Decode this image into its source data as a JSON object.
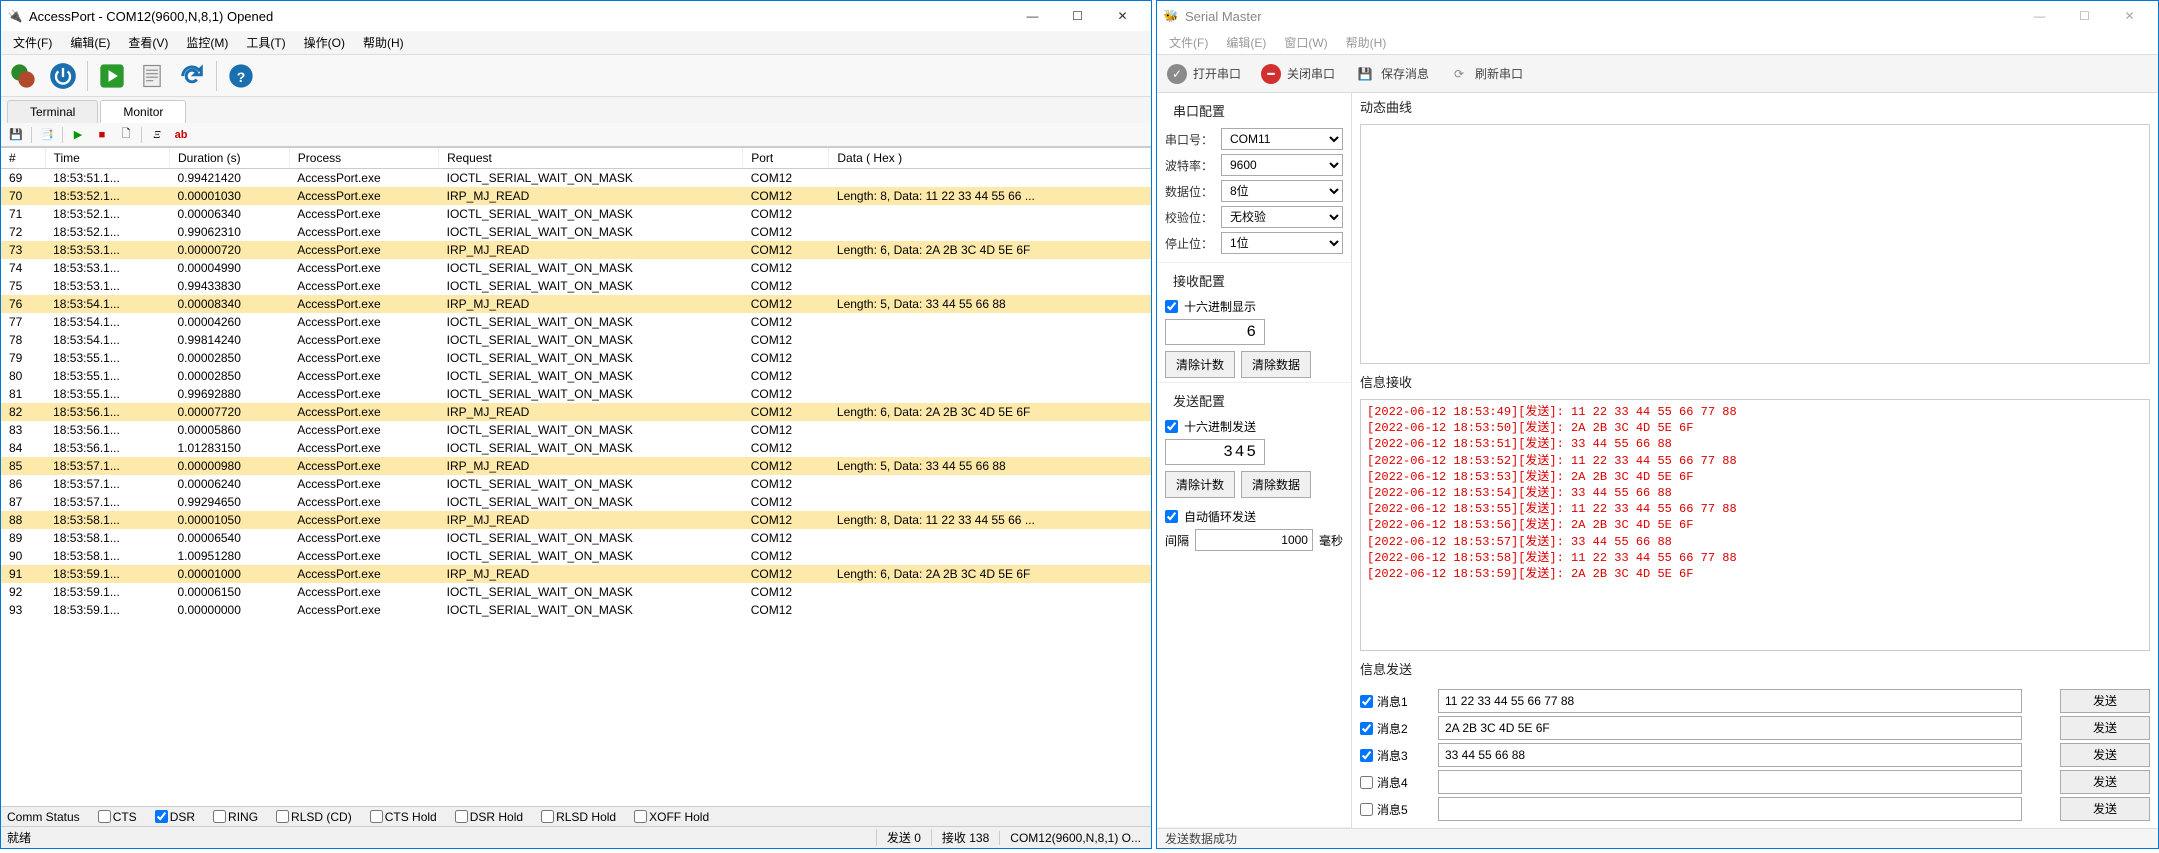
{
  "left": {
    "title": "AccessPort - COM12(9600,N,8,1) Opened",
    "menu": [
      "文件(F)",
      "编辑(E)",
      "查看(V)",
      "监控(M)",
      "工具(T)",
      "操作(O)",
      "帮助(H)"
    ],
    "tabs": {
      "terminal": "Terminal",
      "monitor": "Monitor"
    },
    "columns": [
      "#",
      "Time",
      "Duration (s)",
      "Process",
      "Request",
      "Port",
      "Data ( Hex )"
    ],
    "rows": [
      {
        "n": "69",
        "t": "18:53:51.1...",
        "d": "0.99421420",
        "p": "AccessPort.exe",
        "r": "IOCTL_SERIAL_WAIT_ON_MASK",
        "port": "COM12",
        "data": "",
        "hl": false
      },
      {
        "n": "70",
        "t": "18:53:52.1...",
        "d": "0.00001030",
        "p": "AccessPort.exe",
        "r": "IRP_MJ_READ",
        "port": "COM12",
        "data": "Length: 8, Data: 11 22 33 44 55 66 ...",
        "hl": true
      },
      {
        "n": "71",
        "t": "18:53:52.1...",
        "d": "0.00006340",
        "p": "AccessPort.exe",
        "r": "IOCTL_SERIAL_WAIT_ON_MASK",
        "port": "COM12",
        "data": "",
        "hl": false
      },
      {
        "n": "72",
        "t": "18:53:52.1...",
        "d": "0.99062310",
        "p": "AccessPort.exe",
        "r": "IOCTL_SERIAL_WAIT_ON_MASK",
        "port": "COM12",
        "data": "",
        "hl": false
      },
      {
        "n": "73",
        "t": "18:53:53.1...",
        "d": "0.00000720",
        "p": "AccessPort.exe",
        "r": "IRP_MJ_READ",
        "port": "COM12",
        "data": "Length: 6, Data: 2A 2B 3C 4D 5E 6F",
        "hl": true
      },
      {
        "n": "74",
        "t": "18:53:53.1...",
        "d": "0.00004990",
        "p": "AccessPort.exe",
        "r": "IOCTL_SERIAL_WAIT_ON_MASK",
        "port": "COM12",
        "data": "",
        "hl": false
      },
      {
        "n": "75",
        "t": "18:53:53.1...",
        "d": "0.99433830",
        "p": "AccessPort.exe",
        "r": "IOCTL_SERIAL_WAIT_ON_MASK",
        "port": "COM12",
        "data": "",
        "hl": false
      },
      {
        "n": "76",
        "t": "18:53:54.1...",
        "d": "0.00008340",
        "p": "AccessPort.exe",
        "r": "IRP_MJ_READ",
        "port": "COM12",
        "data": "Length: 5, Data: 33 44 55 66 88",
        "hl": true
      },
      {
        "n": "77",
        "t": "18:53:54.1...",
        "d": "0.00004260",
        "p": "AccessPort.exe",
        "r": "IOCTL_SERIAL_WAIT_ON_MASK",
        "port": "COM12",
        "data": "",
        "hl": false
      },
      {
        "n": "78",
        "t": "18:53:54.1...",
        "d": "0.99814240",
        "p": "AccessPort.exe",
        "r": "IOCTL_SERIAL_WAIT_ON_MASK",
        "port": "COM12",
        "data": "",
        "hl": false
      },
      {
        "n": "79",
        "t": "18:53:55.1...",
        "d": "0.00002850",
        "p": "AccessPort.exe",
        "r": "IOCTL_SERIAL_WAIT_ON_MASK",
        "port": "COM12",
        "data": "",
        "hl": false
      },
      {
        "n": "80",
        "t": "18:53:55.1...",
        "d": "0.00002850",
        "p": "AccessPort.exe",
        "r": "IOCTL_SERIAL_WAIT_ON_MASK",
        "port": "COM12",
        "data": "",
        "hl": false
      },
      {
        "n": "81",
        "t": "18:53:55.1...",
        "d": "0.99692880",
        "p": "AccessPort.exe",
        "r": "IOCTL_SERIAL_WAIT_ON_MASK",
        "port": "COM12",
        "data": "",
        "hl": false
      },
      {
        "n": "82",
        "t": "18:53:56.1...",
        "d": "0.00007720",
        "p": "AccessPort.exe",
        "r": "IRP_MJ_READ",
        "port": "COM12",
        "data": "Length: 6, Data: 2A 2B 3C 4D 5E 6F",
        "hl": true
      },
      {
        "n": "83",
        "t": "18:53:56.1...",
        "d": "0.00005860",
        "p": "AccessPort.exe",
        "r": "IOCTL_SERIAL_WAIT_ON_MASK",
        "port": "COM12",
        "data": "",
        "hl": false
      },
      {
        "n": "84",
        "t": "18:53:56.1...",
        "d": "1.01283150",
        "p": "AccessPort.exe",
        "r": "IOCTL_SERIAL_WAIT_ON_MASK",
        "port": "COM12",
        "data": "",
        "hl": false
      },
      {
        "n": "85",
        "t": "18:53:57.1...",
        "d": "0.00000980",
        "p": "AccessPort.exe",
        "r": "IRP_MJ_READ",
        "port": "COM12",
        "data": "Length: 5, Data: 33 44 55 66 88",
        "hl": true
      },
      {
        "n": "86",
        "t": "18:53:57.1...",
        "d": "0.00006240",
        "p": "AccessPort.exe",
        "r": "IOCTL_SERIAL_WAIT_ON_MASK",
        "port": "COM12",
        "data": "",
        "hl": false
      },
      {
        "n": "87",
        "t": "18:53:57.1...",
        "d": "0.99294650",
        "p": "AccessPort.exe",
        "r": "IOCTL_SERIAL_WAIT_ON_MASK",
        "port": "COM12",
        "data": "",
        "hl": false
      },
      {
        "n": "88",
        "t": "18:53:58.1...",
        "d": "0.00001050",
        "p": "AccessPort.exe",
        "r": "IRP_MJ_READ",
        "port": "COM12",
        "data": "Length: 8, Data: 11 22 33 44 55 66 ...",
        "hl": true
      },
      {
        "n": "89",
        "t": "18:53:58.1...",
        "d": "0.00006540",
        "p": "AccessPort.exe",
        "r": "IOCTL_SERIAL_WAIT_ON_MASK",
        "port": "COM12",
        "data": "",
        "hl": false
      },
      {
        "n": "90",
        "t": "18:53:58.1...",
        "d": "1.00951280",
        "p": "AccessPort.exe",
        "r": "IOCTL_SERIAL_WAIT_ON_MASK",
        "port": "COM12",
        "data": "",
        "hl": false
      },
      {
        "n": "91",
        "t": "18:53:59.1...",
        "d": "0.00001000",
        "p": "AccessPort.exe",
        "r": "IRP_MJ_READ",
        "port": "COM12",
        "data": "Length: 6, Data: 2A 2B 3C 4D 5E 6F",
        "hl": true
      },
      {
        "n": "92",
        "t": "18:53:59.1...",
        "d": "0.00006150",
        "p": "AccessPort.exe",
        "r": "IOCTL_SERIAL_WAIT_ON_MASK",
        "port": "COM12",
        "data": "",
        "hl": false
      },
      {
        "n": "93",
        "t": "18:53:59.1...",
        "d": "0.00000000",
        "p": "AccessPort.exe",
        "r": "IOCTL_SERIAL_WAIT_ON_MASK",
        "port": "COM12",
        "data": "",
        "hl": false
      }
    ],
    "comm": {
      "label": "Comm Status",
      "cts": "CTS",
      "dsr": "DSR",
      "ring": "RING",
      "rlsd": "RLSD (CD)",
      "ctsh": "CTS Hold",
      "dsrh": "DSR Hold",
      "rlsdh": "RLSD Hold",
      "xoffh": "XOFF Hold"
    },
    "status": {
      "ready": "就绪",
      "tx": "发送 0",
      "rx": "接收 138",
      "port": "COM12(9600,N,8,1) O..."
    }
  },
  "right": {
    "title": "Serial Master",
    "menu": [
      "文件(F)",
      "编辑(E)",
      "窗口(W)",
      "帮助(H)"
    ],
    "tb": {
      "open": "打开串口",
      "close": "关闭串口",
      "save": "保存消息",
      "refresh": "刷新串口"
    },
    "cfg": {
      "title": "串口配置",
      "port_l": "串口号：",
      "port_v": "COM11",
      "baud_l": "波特率：",
      "baud_v": "9600",
      "bits_l": "数据位：",
      "bits_v": "8位",
      "par_l": "校验位：",
      "par_v": "无校验",
      "stop_l": "停止位：",
      "stop_v": "1位"
    },
    "rxcfg": {
      "title": "接收配置",
      "hex": "十六进制显示",
      "count": "6",
      "clrc": "清除计数",
      "clrd": "清除数据"
    },
    "txcfg": {
      "title": "发送配置",
      "hex": "十六进制发送",
      "count": "345",
      "clrc": "清除计数",
      "clrd": "清除数据",
      "loop": "自动循环发送",
      "int_l": "间隔",
      "int_v": "1000",
      "int_u": "毫秒"
    },
    "curve": "动态曲线",
    "rxtitle": "信息接收",
    "rxlines": [
      "[2022-06-12 18:53:49][发送]: 11 22 33 44 55 66 77 88",
      "[2022-06-12 18:53:50][发送]: 2A 2B 3C 4D 5E 6F",
      "[2022-06-12 18:53:51][发送]: 33 44 55 66 88",
      "[2022-06-12 18:53:52][发送]: 11 22 33 44 55 66 77 88",
      "[2022-06-12 18:53:53][发送]: 2A 2B 3C 4D 5E 6F",
      "[2022-06-12 18:53:54][发送]: 33 44 55 66 88",
      "[2022-06-12 18:53:55][发送]: 11 22 33 44 55 66 77 88",
      "[2022-06-12 18:53:56][发送]: 2A 2B 3C 4D 5E 6F",
      "[2022-06-12 18:53:57][发送]: 33 44 55 66 88",
      "[2022-06-12 18:53:58][发送]: 11 22 33 44 55 66 77 88",
      "[2022-06-12 18:53:59][发送]: 2A 2B 3C 4D 5E 6F"
    ],
    "txtitle": "信息发送",
    "sendbtn": "发送",
    "msgs": [
      {
        "label": "消息1",
        "chk": true,
        "val": "11 22 33 44 55 66 77 88"
      },
      {
        "label": "消息2",
        "chk": true,
        "val": "2A 2B 3C 4D 5E 6F"
      },
      {
        "label": "消息3",
        "chk": true,
        "val": "33 44 55 66 88"
      },
      {
        "label": "消息4",
        "chk": false,
        "val": ""
      },
      {
        "label": "消息5",
        "chk": false,
        "val": ""
      }
    ],
    "status": "发送数据成功"
  }
}
